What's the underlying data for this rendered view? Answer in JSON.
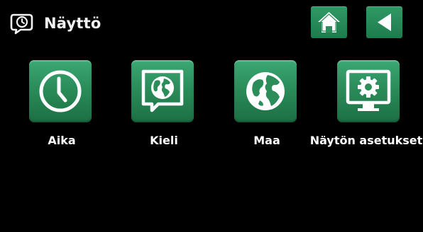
{
  "header": {
    "title": "Näyttö",
    "title_icon": "display-chat-icon",
    "home_icon": "home-icon",
    "back_icon": "back-arrow-icon"
  },
  "tiles": [
    {
      "label": "Aika",
      "icon": "clock-icon"
    },
    {
      "label": "Kieli",
      "icon": "language-globe-bubble-icon"
    },
    {
      "label": "Maa",
      "icon": "globe-icon"
    },
    {
      "label": "Näytön asetukset",
      "icon": "monitor-gear-icon"
    }
  ],
  "colors": {
    "background": "#000000",
    "accent_green": "#2a8d5a",
    "text": "#ffffff"
  }
}
